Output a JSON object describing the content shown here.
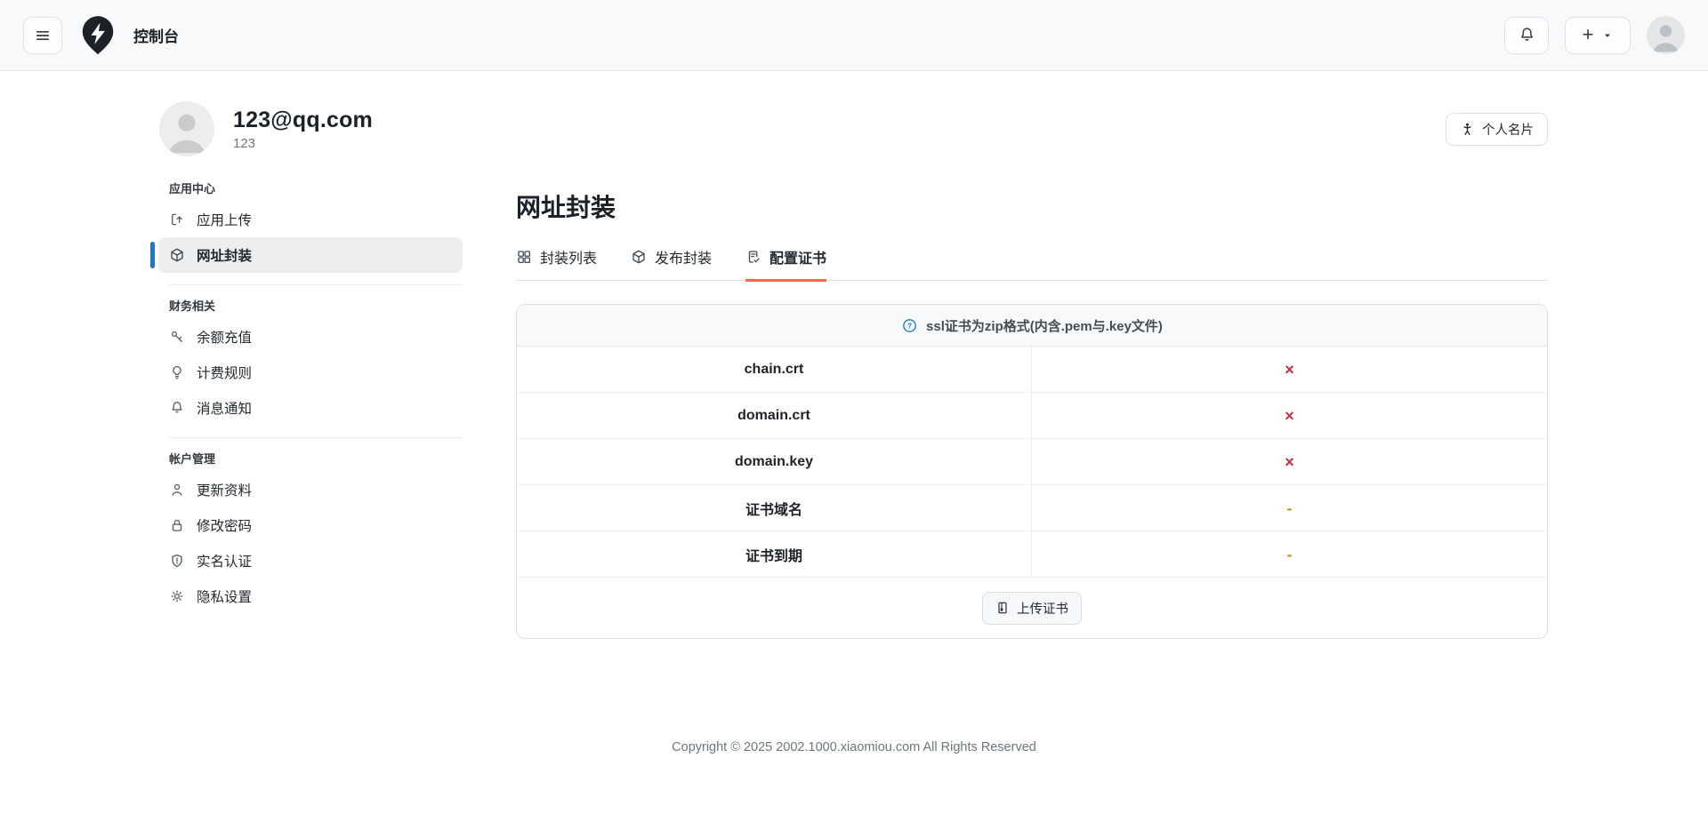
{
  "navbar": {
    "title": "控制台",
    "new_button": {
      "plus": "+"
    }
  },
  "profile": {
    "email": "123@qq.com",
    "username": "123",
    "card_button_label": "个人名片"
  },
  "sidebar": {
    "sections": [
      {
        "header": "应用中心",
        "items": [
          {
            "label": "应用上传",
            "icon": "upload-icon",
            "active": false
          },
          {
            "label": "网址封装",
            "icon": "cube-icon",
            "active": true
          }
        ]
      },
      {
        "header": "财务相关",
        "items": [
          {
            "label": "余额充值",
            "icon": "key-icon",
            "active": false
          },
          {
            "label": "计费规则",
            "icon": "bulb-icon",
            "active": false
          },
          {
            "label": "消息通知",
            "icon": "bell-icon",
            "active": false
          }
        ]
      },
      {
        "header": "帐户管理",
        "items": [
          {
            "label": "更新资料",
            "icon": "user-icon",
            "active": false
          },
          {
            "label": "修改密码",
            "icon": "lock-icon",
            "active": false
          },
          {
            "label": "实名认证",
            "icon": "shield-icon",
            "active": false
          },
          {
            "label": "隐私设置",
            "icon": "gear-icon",
            "active": false
          }
        ]
      }
    ]
  },
  "main": {
    "title": "网址封装",
    "tabs": [
      {
        "label": "封装列表",
        "icon": "grid-icon",
        "active": false
      },
      {
        "label": "发布封装",
        "icon": "cube-icon",
        "active": false
      },
      {
        "label": "配置证书",
        "icon": "file-check-icon",
        "active": true
      }
    ],
    "cert_panel": {
      "notice": "ssl证书为zip格式(内含.pem与.key文件)",
      "notice_icon": "question-circle-icon",
      "rows": [
        {
          "label": "chain.crt",
          "status": "×",
          "status_type": "missing"
        },
        {
          "label": "domain.crt",
          "status": "×",
          "status_type": "missing"
        },
        {
          "label": "domain.key",
          "status": "×",
          "status_type": "missing"
        },
        {
          "label": "证书域名",
          "status": "-",
          "status_type": "empty"
        },
        {
          "label": "证书到期",
          "status": "-",
          "status_type": "empty"
        }
      ],
      "upload_button_label": "上传证书",
      "upload_button_icon": "zip-file-icon"
    }
  },
  "footer": {
    "copyright": "Copyright © 2025 2002.1000.xiaomiou.com All Rights Reserved"
  },
  "icons": {
    "hamburger-icon": "three horizontal bars",
    "lightning-pin-logo": "black map-pin with white lightning bolt",
    "bell-icon": "notification bell outline",
    "plus-icon": "+",
    "caret-down-icon": "▾",
    "avatar-person-icon": "gray person silhouette",
    "person-card-icon": "standing person figure",
    "upload-icon": "bracket with up arrow",
    "cube-icon": "3d package cube outline",
    "key-icon": "diagonal key",
    "bulb-icon": "lightbulb outline",
    "user-icon": "person outline",
    "lock-icon": "padlock outline",
    "shield-icon": "shield with exclamation",
    "gear-icon": "settings gear",
    "grid-icon": "2x2 squares",
    "file-check-icon": "document with checkmark",
    "question-circle-icon": "blue circled question mark",
    "zip-file-icon": "document with zipper"
  },
  "colors": {
    "navbar_bg": "#f8f9fa",
    "accent_blue": "#1f75cb",
    "danger_red": "#c5303e",
    "warning_amber": "#c29420",
    "tab_underline": "#f4694f",
    "border": "#dee2e6"
  }
}
